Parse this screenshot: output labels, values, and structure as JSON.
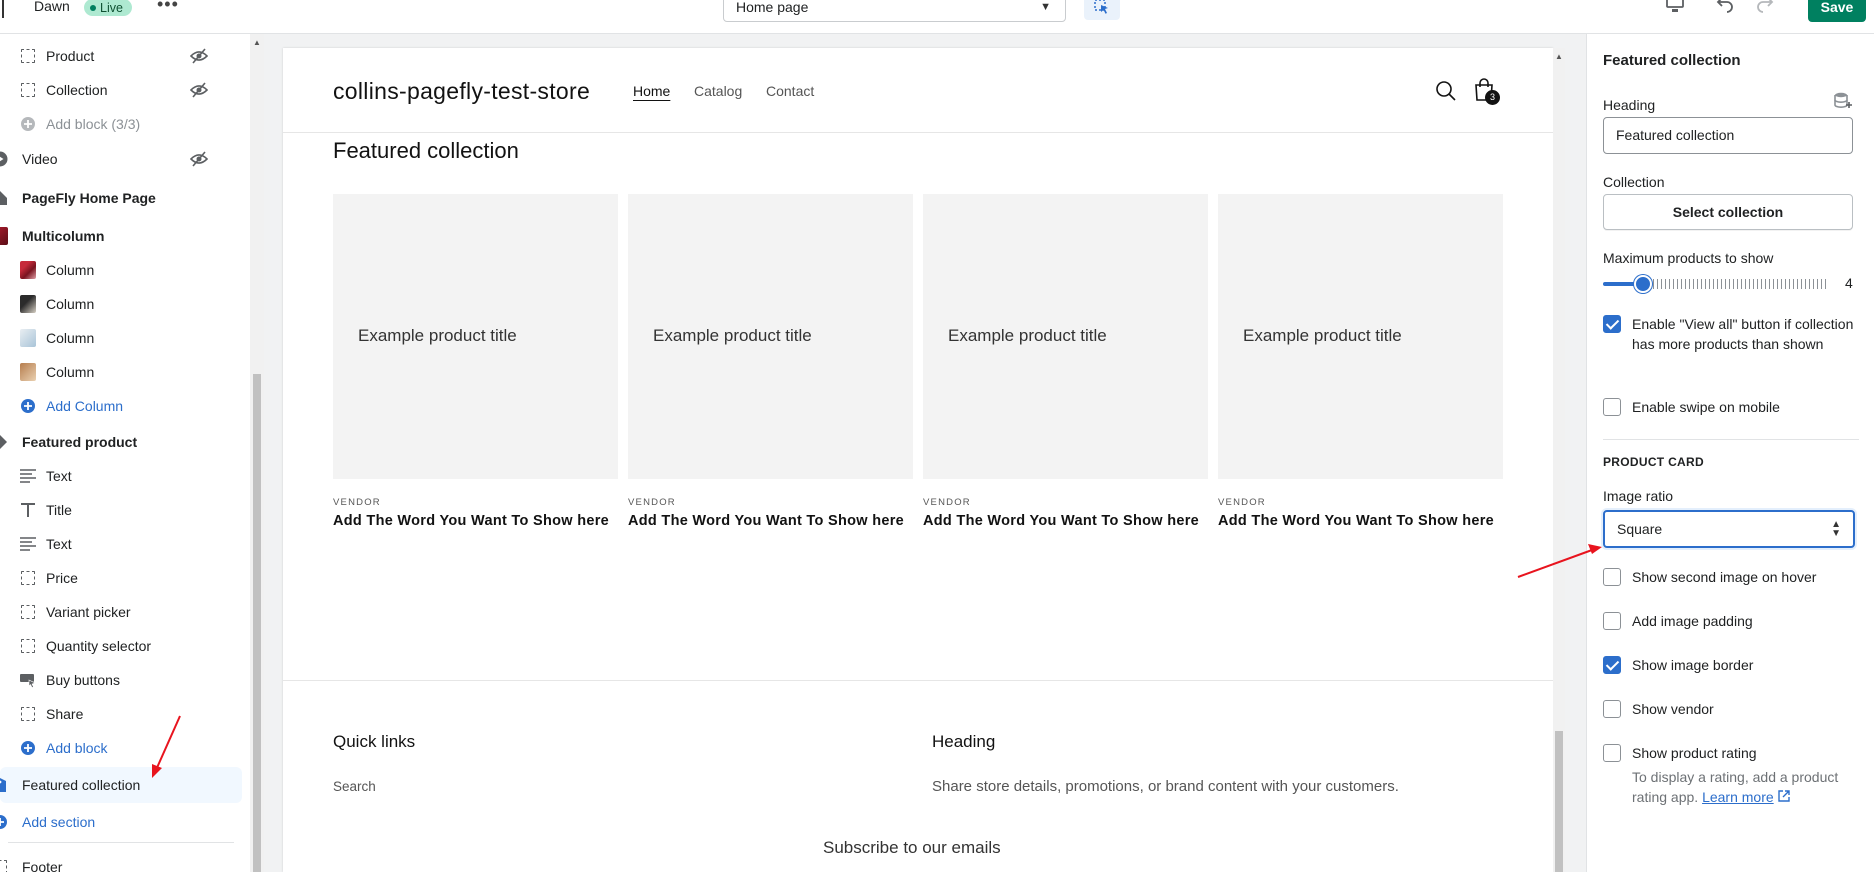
{
  "topbar": {
    "theme_name": "Dawn",
    "live_badge": "Live",
    "page_select": "Home page",
    "save_label": "Save"
  },
  "sidebar": {
    "items": [
      {
        "label": "Product",
        "kind": "child",
        "icon": "block-icon",
        "hidden": true,
        "muted": false
      },
      {
        "label": "Collection",
        "kind": "child",
        "icon": "block-icon",
        "hidden": true,
        "muted": false
      },
      {
        "label": "Add block (3/3)",
        "kind": "child",
        "icon": "plus-circle-icon",
        "hidden": false,
        "muted": true
      },
      {
        "label": "Video",
        "kind": "section",
        "icon": "play-icon",
        "hidden": true
      },
      {
        "label": "PageFly Home Page",
        "kind": "section",
        "icon": "home-icon",
        "hidden": false
      },
      {
        "label": "Multicolumn",
        "kind": "section",
        "icon": "multicolumn-icon",
        "hidden": false
      },
      {
        "label": "Column",
        "kind": "child",
        "icon": "column-thumb-red"
      },
      {
        "label": "Column",
        "kind": "child",
        "icon": "column-thumb-dark"
      },
      {
        "label": "Column",
        "kind": "child",
        "icon": "column-thumb-light"
      },
      {
        "label": "Column",
        "kind": "child",
        "icon": "column-thumb-brown"
      },
      {
        "label": "Add Column",
        "kind": "child",
        "icon": "plus-circle-icon",
        "link": true
      },
      {
        "label": "Featured product",
        "kind": "section",
        "icon": "tag-icon"
      },
      {
        "label": "Text",
        "kind": "child",
        "icon": "text-lines-icon"
      },
      {
        "label": "Title",
        "kind": "child",
        "icon": "title-icon"
      },
      {
        "label": "Text",
        "kind": "child",
        "icon": "text-lines-icon"
      },
      {
        "label": "Price",
        "kind": "child",
        "icon": "block-icon"
      },
      {
        "label": "Variant picker",
        "kind": "child",
        "icon": "block-icon"
      },
      {
        "label": "Quantity selector",
        "kind": "child",
        "icon": "block-icon"
      },
      {
        "label": "Buy buttons",
        "kind": "child",
        "icon": "buy-button-icon"
      },
      {
        "label": "Share",
        "kind": "child",
        "icon": "block-icon"
      },
      {
        "label": "Add block",
        "kind": "child",
        "icon": "plus-circle-icon",
        "link": true
      },
      {
        "label": "Featured collection",
        "kind": "section",
        "icon": "collection-tag-icon",
        "selected": true
      },
      {
        "label": "Add section",
        "kind": "section-link",
        "icon": "plus-circle-icon",
        "link": true
      },
      {
        "label": "Footer",
        "kind": "section",
        "icon": "block-icon"
      }
    ]
  },
  "preview": {
    "store_name": "collins-pagefly-test-store",
    "nav": [
      "Home",
      "Catalog",
      "Contact"
    ],
    "cart_count": "3",
    "section_heading": "Featured collection",
    "cards": [
      {
        "image_title": "Example product title",
        "vendor": "VENDOR",
        "name": "Add The Word You Want To Show here"
      },
      {
        "image_title": "Example product title",
        "vendor": "VENDOR",
        "name": "Add The Word You Want To Show here"
      },
      {
        "image_title": "Example product title",
        "vendor": "VENDOR",
        "name": "Add The Word You Want To Show here"
      },
      {
        "image_title": "Example product title",
        "vendor": "VENDOR",
        "name": "Add The Word You Want To Show here"
      }
    ],
    "footer": {
      "quick_links_heading": "Quick links",
      "quick_link": "Search",
      "heading2": "Heading",
      "heading2_text": "Share store details, promotions, or brand content with your customers.",
      "subscribe": "Subscribe to our emails"
    }
  },
  "settings": {
    "title": "Featured collection",
    "heading_label": "Heading",
    "heading_value": "Featured collection",
    "collection_label": "Collection",
    "select_collection": "Select collection",
    "max_products_label": "Maximum products to show",
    "max_products_value": "4",
    "max_products_fraction": 0.18,
    "view_all": {
      "label": "Enable \"View all\" button if collection has more products than shown",
      "checked": true
    },
    "swipe": {
      "label": "Enable swipe on mobile",
      "checked": false
    },
    "product_card_heading": "PRODUCT CARD",
    "image_ratio_label": "Image ratio",
    "image_ratio_value": "Square",
    "second_image": {
      "label": "Show second image on hover",
      "checked": false
    },
    "image_padding": {
      "label": "Add image padding",
      "checked": false
    },
    "image_border": {
      "label": "Show image border",
      "checked": true
    },
    "vendor": {
      "label": "Show vendor",
      "checked": false
    },
    "rating": {
      "label": "Show product rating",
      "checked": false
    },
    "rating_help": "To display a rating, add a product rating app.",
    "learn_more": "Learn more"
  },
  "colors": {
    "accent": "#2c6ecb",
    "save": "#008060",
    "annotation_arrow": "#e8141e"
  }
}
